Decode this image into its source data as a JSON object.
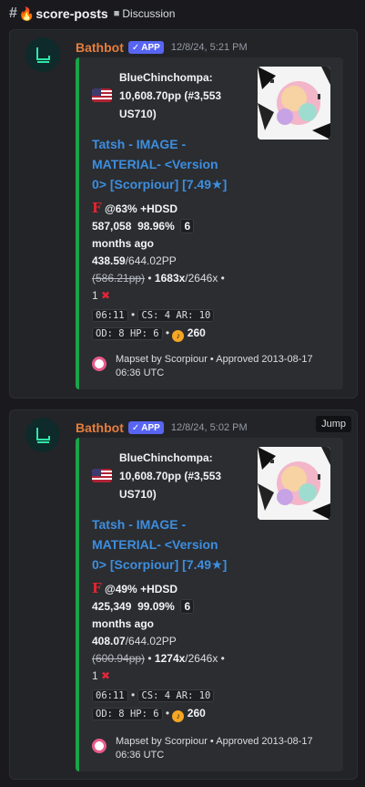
{
  "topbar": {
    "channel": "score-posts",
    "breadcrumb": "Discussion"
  },
  "messages": [
    {
      "author": "Bathbot",
      "badge": "APP",
      "timestamp": "12/8/24, 5:21 PM",
      "embed": {
        "user_line1": "BlueChinchompa:",
        "user_line2": "10,608.70pp (#3,553",
        "user_line3": "US710)",
        "title_line1": "Tatsh - IMAGE -",
        "title_line2": "MATERIAL- <Version",
        "title_line3": "0> [Scorpiour] [7.49★]",
        "grade": "F",
        "progress": "@63%",
        "mods": "+HDSD",
        "score": "587,058",
        "accuracy": "98.96%",
        "time_num": "6",
        "time_unit": "months ago",
        "pp": "438.59",
        "pp_max": "/644.02PP",
        "pp_fc": "(586.21pp)",
        "combo": "1683x",
        "max_combo": "/2646x",
        "misses": "1",
        "length": "06:11",
        "cs": "CS: 4",
        "ar": "AR: 10",
        "od": "OD: 8",
        "hp": "HP: 6",
        "bpm": "260",
        "footer_line1": "Mapset by Scorpiour • Approved 2013-08-17",
        "footer_line2": "06:36 UTC"
      }
    },
    {
      "author": "Bathbot",
      "badge": "APP",
      "timestamp": "12/8/24, 5:02 PM",
      "jump": "Jump",
      "embed": {
        "user_line1": "BlueChinchompa:",
        "user_line2": "10,608.70pp (#3,553",
        "user_line3": "US710)",
        "title_line1": "Tatsh - IMAGE -",
        "title_line2": "MATERIAL- <Version",
        "title_line3": "0> [Scorpiour] [7.49★]",
        "grade": "F",
        "progress": "@49%",
        "mods": "+HDSD",
        "score": "425,349",
        "accuracy": "99.09%",
        "time_num": "6",
        "time_unit": "months ago",
        "pp": "408.07",
        "pp_max": "/644.02PP",
        "pp_fc": "(600.94pp)",
        "combo": "1274x",
        "max_combo": "/2646x",
        "misses": "1",
        "length": "06:11",
        "cs": "CS: 4",
        "ar": "AR: 10",
        "od": "OD: 8",
        "hp": "HP: 6",
        "bpm": "260",
        "footer_line1": "Mapset by Scorpiour • Approved 2013-08-17",
        "footer_line2": "06:36 UTC"
      }
    }
  ]
}
